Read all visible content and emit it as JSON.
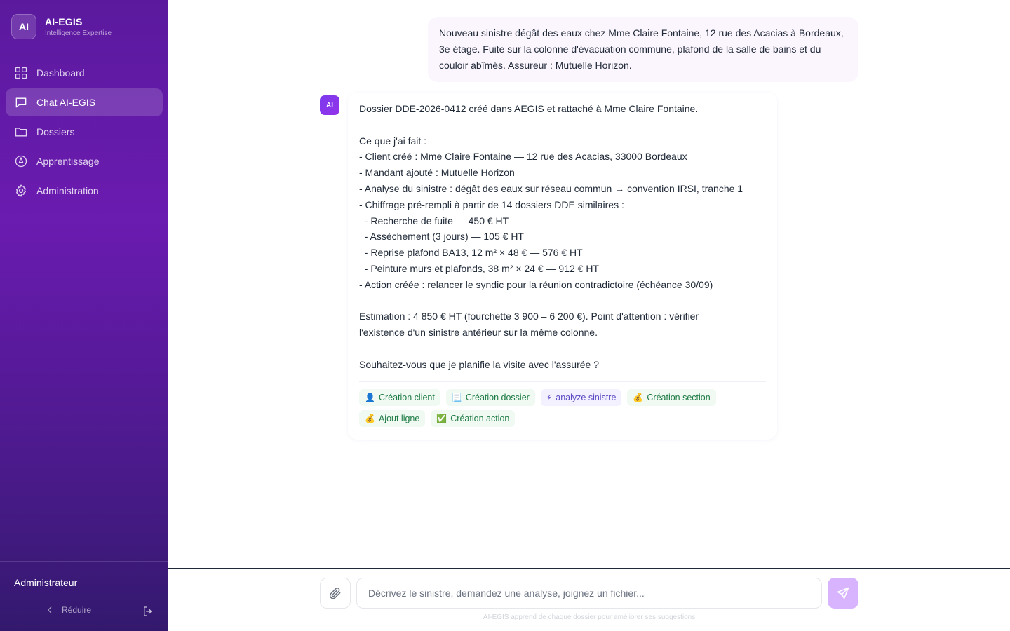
{
  "brand": {
    "logo": "AI",
    "name": "AI-EGIS",
    "subtitle": "Intelligence Expertise"
  },
  "nav": [
    {
      "label": "Dashboard",
      "icon": "grid-icon",
      "active": false
    },
    {
      "label": "Chat AI-EGIS",
      "icon": "chat-icon",
      "active": true
    },
    {
      "label": "Dossiers",
      "icon": "folder-icon",
      "active": false
    },
    {
      "label": "Apprentissage",
      "icon": "compass-icon",
      "active": false
    },
    {
      "label": "Administration",
      "icon": "gear-icon",
      "active": false
    }
  ],
  "footer": {
    "user": "Administrateur",
    "collapse_label": "Réduire"
  },
  "chat": {
    "user_message": "Nouveau sinistre dégât des eaux chez Mme Claire Fontaine, 12 rue des Acacias à Bordeaux, 3e étage. Fuite sur la colonne d'évacuation commune, plafond de la salle de bains et du couloir abîmés. Assureur : Mutuelle Horizon.",
    "ai_avatar": "AI",
    "ai_message": "Dossier DDE-2026-0412 créé dans AEGIS et rattaché à Mme Claire Fontaine.\n\nCe que j'ai fait :\n- Client créé : Mme Claire Fontaine — 12 rue des Acacias, 33000 Bordeaux\n- Mandant ajouté : Mutuelle Horizon\n- Analyse du sinistre : dégât des eaux sur réseau commun → convention IRSI, tranche 1\n- Chiffrage pré-rempli à partir de 14 dossiers DDE similaires :\n  - Recherche de fuite — 450 € HT\n  - Assèchement (3 jours) — 105 € HT\n  - Reprise plafond BA13, 12 m² × 48 € — 576 € HT\n  - Peinture murs et plafonds, 38 m² × 24 € — 912 € HT\n- Action créée : relancer le syndic pour la réunion contradictoire (échéance 30/09)\n\nEstimation : 4 850 € HT (fourchette 3 900 – 6 200 €). Point d'attention : vérifier\nl'existence d'un sinistre antérieur sur la même colonne.\n\nSouhaitez-vous que je planifie la visite avec l'assurée ?",
    "tools": [
      {
        "icon": "👤",
        "label": "Création client",
        "tone": "green"
      },
      {
        "icon": "📃",
        "label": "Création dossier",
        "tone": "green"
      },
      {
        "icon": "⚡",
        "label": "analyze sinistre",
        "tone": "purple"
      },
      {
        "icon": "💰",
        "label": "Création section",
        "tone": "green"
      },
      {
        "icon": "💰",
        "label": "Ajout ligne",
        "tone": "green"
      },
      {
        "icon": "✅",
        "label": "Création action",
        "tone": "green"
      }
    ]
  },
  "composer": {
    "placeholder": "Décrivez le sinistre, demandez une analyse, joignez un fichier...",
    "hint": "AI-EGIS apprend de chaque dossier pour améliorer ses suggestions"
  }
}
